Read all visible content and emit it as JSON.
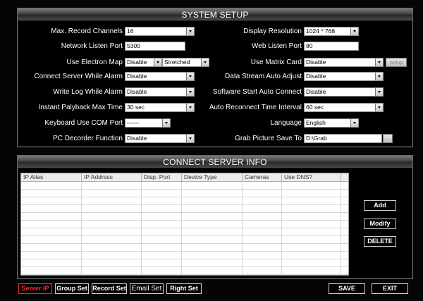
{
  "system_setup": {
    "title": "SYSTEM SETUP",
    "left_fields": [
      {
        "label": "Max. Record Channels",
        "value": "16",
        "type": "combo"
      },
      {
        "label": "Network Listen Port",
        "value": "5300",
        "type": "text"
      },
      {
        "label": "Use Electron Map",
        "value": "Disable",
        "value2": "Stretched",
        "type": "combo2"
      },
      {
        "label": "Connect Server While Alarm",
        "value": "Disable",
        "type": "combo"
      },
      {
        "label": "Write Log While Alarm",
        "value": "Disable",
        "type": "combo"
      },
      {
        "label": "Instant Palyback Max Time",
        "value": "30 sec",
        "type": "combo"
      },
      {
        "label": "Keyboard Use COM Port",
        "value": "——",
        "type": "combo"
      },
      {
        "label": "PC Decorder Function",
        "value": "Disable",
        "type": "combo"
      }
    ],
    "right_fields": [
      {
        "label": "Display Resolution",
        "value": "1024 * 768",
        "type": "combo"
      },
      {
        "label": "Web Listen Port",
        "value": "80",
        "type": "text"
      },
      {
        "label": "Use Matrix Card",
        "value": "Disable",
        "type": "combo",
        "extra_button": "Setup"
      },
      {
        "label": "Data Stream Auto Adjust",
        "value": "Disable",
        "type": "combo"
      },
      {
        "label": "Software Start Auto Connect",
        "value": "Disable",
        "type": "combo"
      },
      {
        "label": "Auto Reconnect Time Interval",
        "value": "60 sec",
        "type": "combo"
      },
      {
        "label": "Language",
        "value": "English",
        "type": "combo"
      },
      {
        "label": "Grab Picture Save To",
        "value": "D:\\Grab",
        "type": "browse",
        "extra_button": "..."
      }
    ]
  },
  "connect_server": {
    "title": "CONNECT SERVER INFO",
    "columns": [
      "IP Alias",
      "IP Address",
      "Disp. Port",
      "Device Type",
      "Cameras",
      "Use DNS?"
    ],
    "rows": [],
    "buttons": {
      "add": "Add",
      "modify": "Modify",
      "delete": "DELETE"
    }
  },
  "bottom_bar": {
    "tabs": [
      {
        "label": "Server IP",
        "active": true
      },
      {
        "label": "Group Set",
        "active": false
      },
      {
        "label": "Record Set",
        "active": false
      },
      {
        "label": "Email Set",
        "active": false
      },
      {
        "label": "Right Set",
        "active": false
      }
    ],
    "save": "SAVE",
    "exit": "EXIT"
  },
  "colors": {
    "active_tab": "#ff2a2a",
    "background": "#000000",
    "title_bar": "#4a4a4a"
  }
}
